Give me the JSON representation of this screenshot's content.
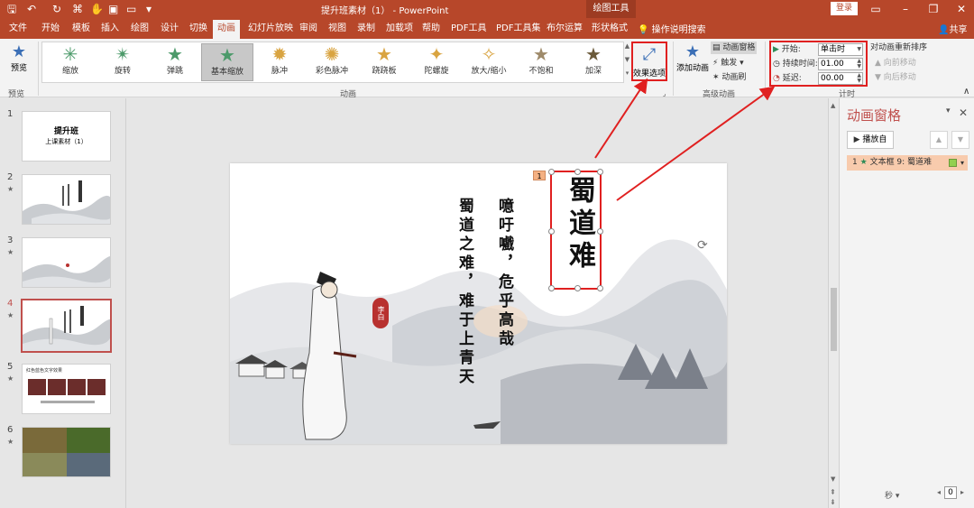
{
  "titlebar": {
    "doc_title": "提升班素材（1） - PowerPoint",
    "contextual_tab": "绘图工具",
    "login": "登录"
  },
  "tabs": [
    "文件",
    "开始",
    "模板",
    "插入",
    "绘图",
    "设计",
    "切换",
    "动画",
    "幻灯片放映",
    "审阅",
    "视图",
    "录制",
    "加载项",
    "帮助",
    "PDF工具",
    "PDF工具集",
    "布尔运算",
    "形状格式"
  ],
  "active_tab": "动画",
  "search_label": "操作说明搜索",
  "share_label": "共享",
  "ribbon": {
    "preview_label": "预览",
    "preview_group": "预览",
    "animation_group": "动画",
    "advanced_group": "高级动画",
    "timing_group": "计时",
    "gallery": [
      "缩放",
      "旋转",
      "弹跳",
      "基本缩放",
      "脉冲",
      "彩色脉冲",
      "跷跷板",
      "陀螺旋",
      "放大/缩小",
      "不饱和",
      "加深"
    ],
    "selected_effect": "基本缩放",
    "effect_options": "效果选项",
    "add_animation": "添加动画",
    "animation_pane_btn": "动画窗格",
    "trigger": "触发",
    "animation_painter": "动画刷",
    "start_label": "开始:",
    "start_value": "单击时",
    "duration_label": "持续时间:",
    "duration_value": "01.00",
    "delay_label": "延迟:",
    "delay_value": "00.00",
    "reorder_title": "对动画重新排序",
    "move_earlier": "向前移动",
    "move_later": "向后移动"
  },
  "thumbnails": [
    {
      "num": "1",
      "title": "提升班",
      "subtitle": "上课素材（1）",
      "star": false
    },
    {
      "num": "2",
      "star": true
    },
    {
      "num": "3",
      "star": true
    },
    {
      "num": "4",
      "star": true,
      "selected": true
    },
    {
      "num": "5",
      "star": true,
      "heading": "红色蓝色文字效果"
    },
    {
      "num": "6",
      "star": true
    }
  ],
  "slide": {
    "title": "蜀道难",
    "line1": "噫吁嚱，危乎高哉",
    "line2": "蜀道之难，难于上青天",
    "seal": "李白",
    "anim_tag": "1"
  },
  "anim_pane": {
    "title": "动画窗格",
    "play_from": "播放自",
    "items": [
      {
        "order": "1",
        "label": "文本框 9: 蜀道难"
      }
    ],
    "seconds_label": "秒",
    "page": "0"
  },
  "colors": {
    "accent": "#b7472a",
    "highlight": "#e02020",
    "list_item": "#f8cbad"
  }
}
